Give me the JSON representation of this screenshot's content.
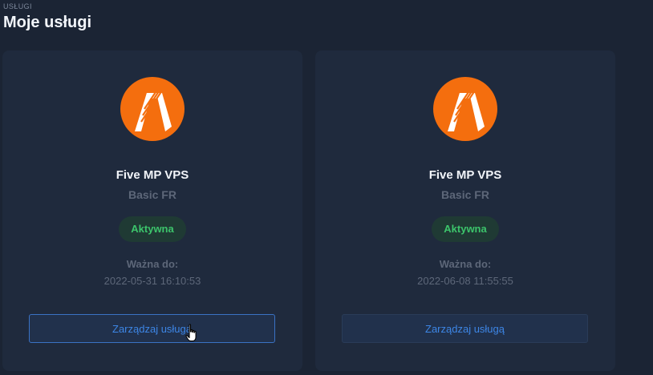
{
  "header": {
    "breadcrumb": "USŁUGI",
    "title": "Moje usługi"
  },
  "services": [
    {
      "name": "Five MP VPS",
      "plan": "Basic FR",
      "status": "Aktywna",
      "valid_label": "Ważna do:",
      "valid_date": "2022-05-31 16:10:53",
      "manage_label": "Zarządzaj usługą"
    },
    {
      "name": "Five MP VPS",
      "plan": "Basic FR",
      "status": "Aktywna",
      "valid_label": "Ważna do:",
      "valid_date": "2022-06-08 11:55:55",
      "manage_label": "Zarządzaj usługą"
    }
  ],
  "colors": {
    "background": "#1b2434",
    "card": "#1f2a3d",
    "logo_orange": "#f46e0e",
    "status_green": "#3cc46b",
    "accent_blue": "#3d86e6"
  },
  "icons": {
    "service_logo": "fivem-logo",
    "cursor": "hand-pointer-cursor"
  }
}
